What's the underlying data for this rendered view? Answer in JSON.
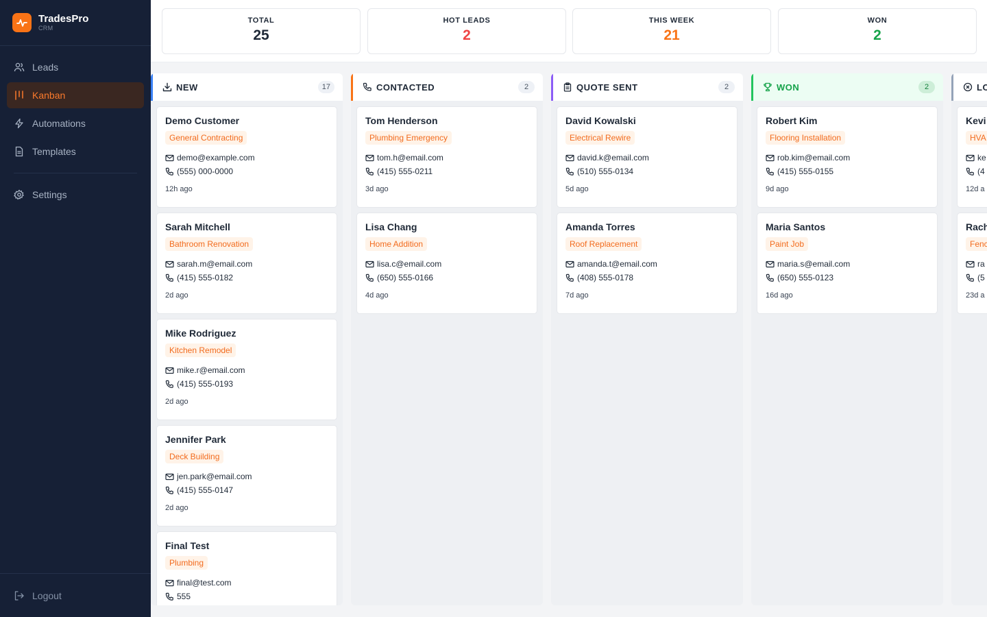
{
  "brand": {
    "name": "TradesPro",
    "sub": "CRM",
    "accent": "#f97316"
  },
  "nav": [
    {
      "label": "Leads",
      "icon": "users-icon"
    },
    {
      "label": "Kanban",
      "icon": "kanban-icon",
      "active": true
    },
    {
      "label": "Automations",
      "icon": "lightning-icon"
    },
    {
      "label": "Templates",
      "icon": "document-icon"
    },
    {
      "label": "Settings",
      "icon": "gear-icon"
    }
  ],
  "logout": {
    "label": "Logout",
    "icon": "logout-icon"
  },
  "stats": [
    {
      "label": "TOTAL",
      "value": "25",
      "color": "#1f2937"
    },
    {
      "label": "HOT LEADS",
      "value": "2",
      "color": "#ef4444"
    },
    {
      "label": "THIS WEEK",
      "value": "21",
      "color": "#f97316"
    },
    {
      "label": "WON",
      "value": "2",
      "color": "#16a34a"
    }
  ],
  "columns": [
    {
      "title": "NEW",
      "count": "17",
      "icon": "download-icon",
      "color": "#3b82f6",
      "cards": [
        {
          "name": "Demo Customer",
          "tag": "General Contracting",
          "email": "demo@example.com",
          "phone": "(555) 000-0000",
          "time": "12h ago"
        },
        {
          "name": "Sarah Mitchell",
          "tag": "Bathroom Renovation",
          "email": "sarah.m@email.com",
          "phone": "(415) 555-0182",
          "time": "2d ago"
        },
        {
          "name": "Mike Rodriguez",
          "tag": "Kitchen Remodel",
          "email": "mike.r@email.com",
          "phone": "(415) 555-0193",
          "time": "2d ago"
        },
        {
          "name": "Jennifer Park",
          "tag": "Deck Building",
          "email": "jen.park@email.com",
          "phone": "(415) 555-0147",
          "time": "2d ago"
        },
        {
          "name": "Final Test",
          "tag": "Plumbing",
          "email": "final@test.com",
          "phone": "555",
          "time": ""
        }
      ]
    },
    {
      "title": "CONTACTED",
      "count": "2",
      "icon": "phone-icon",
      "color": "#f97316",
      "cards": [
        {
          "name": "Tom Henderson",
          "tag": "Plumbing Emergency",
          "email": "tom.h@email.com",
          "phone": "(415) 555-0211",
          "time": "3d ago"
        },
        {
          "name": "Lisa Chang",
          "tag": "Home Addition",
          "email": "lisa.c@email.com",
          "phone": "(650) 555-0166",
          "time": "4d ago"
        }
      ]
    },
    {
      "title": "QUOTE SENT",
      "count": "2",
      "icon": "clipboard-icon",
      "color": "#8b5cf6",
      "cards": [
        {
          "name": "David Kowalski",
          "tag": "Electrical Rewire",
          "email": "david.k@email.com",
          "phone": "(510) 555-0134",
          "time": "5d ago"
        },
        {
          "name": "Amanda Torres",
          "tag": "Roof Replacement",
          "email": "amanda.t@email.com",
          "phone": "(408) 555-0178",
          "time": "7d ago"
        }
      ]
    },
    {
      "title": "WON",
      "count": "2",
      "icon": "trophy-icon",
      "color": "#22c55e",
      "title_color": "#16a34a",
      "head_bg": "#ecfdf3",
      "count_bg": "#cdeed8",
      "count_color": "#15803d",
      "cards": [
        {
          "name": "Robert Kim",
          "tag": "Flooring Installation",
          "email": "rob.kim@email.com",
          "phone": "(415) 555-0155",
          "time": "9d ago"
        },
        {
          "name": "Maria Santos",
          "tag": "Paint Job",
          "email": "maria.s@email.com",
          "phone": "(650) 555-0123",
          "time": "16d ago"
        }
      ]
    },
    {
      "title": "LO",
      "count": "",
      "icon": "x-circle-icon",
      "color": "#94a3b8",
      "cards": [
        {
          "name": "Kevi",
          "tag": "HVA",
          "email": "ke",
          "phone": "(4",
          "time": "12d a"
        },
        {
          "name": "Rach",
          "tag": "Fenc",
          "email": "ra",
          "phone": "(5",
          "time": "23d a"
        }
      ]
    }
  ]
}
